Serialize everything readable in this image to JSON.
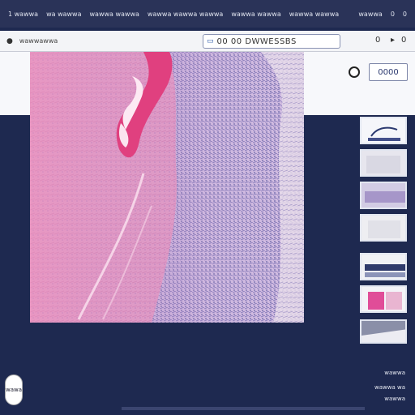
{
  "topbar": {
    "items": [
      "1 wawwa",
      "wa wawwa",
      "wawwa wawwa",
      "wawwa wawwa wawwa",
      "wawwa wawwa",
      "wawwa wawwa"
    ],
    "right": [
      "wawwa",
      "0",
      "0"
    ]
  },
  "toolbar": {
    "title": "wawwawwa",
    "search_text": "00 00 DWWESSBS",
    "right_icons": [
      "0",
      "0"
    ]
  },
  "zoom": {
    "value": "0000"
  },
  "thumbnails": [
    {
      "name": "thumb-1",
      "label": ""
    },
    {
      "name": "thumb-2",
      "label": ""
    },
    {
      "name": "thumb-3",
      "label": ""
    },
    {
      "name": "thumb-4",
      "label": ""
    },
    {
      "name": "thumb-5",
      "label": ""
    },
    {
      "name": "thumb-6",
      "label": ""
    },
    {
      "name": "thumb-7",
      "label": ""
    }
  ],
  "status": {
    "line1": "wawwa",
    "line2": "wawwa wa",
    "line3": "wawwa"
  },
  "fab": {
    "label": "wawa"
  },
  "colors": {
    "background": "#1e2950",
    "panel": "#f7f8fb",
    "tissue_pink": "#e7a6cb",
    "tissue_purple": "#b9a4d6",
    "vessel": "#e0407f"
  }
}
